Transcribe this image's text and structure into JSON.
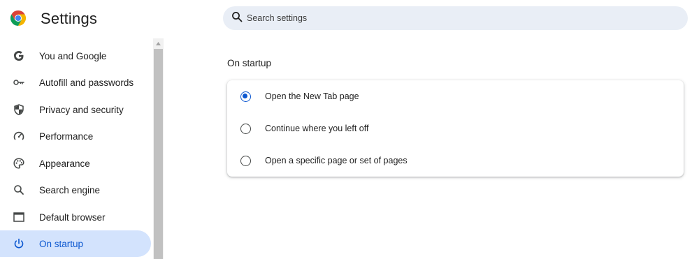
{
  "app": {
    "title": "Settings",
    "logo_icon": "chrome-logo-icon"
  },
  "search": {
    "placeholder": "Search settings",
    "value": ""
  },
  "sidebar": {
    "items": [
      {
        "label": "You and Google",
        "icon": "google-g-icon",
        "active": false
      },
      {
        "label": "Autofill and passwords",
        "icon": "key-icon",
        "active": false
      },
      {
        "label": "Privacy and security",
        "icon": "shield-icon",
        "active": false
      },
      {
        "label": "Performance",
        "icon": "speedometer-icon",
        "active": false
      },
      {
        "label": "Appearance",
        "icon": "palette-icon",
        "active": false
      },
      {
        "label": "Search engine",
        "icon": "search-icon",
        "active": false
      },
      {
        "label": "Default browser",
        "icon": "browser-window-icon",
        "active": false
      },
      {
        "label": "On startup",
        "icon": "power-icon",
        "active": true
      }
    ]
  },
  "main": {
    "section_title": "On startup",
    "options": [
      {
        "label": "Open the New Tab page",
        "checked": true
      },
      {
        "label": "Continue where you left off",
        "checked": false
      },
      {
        "label": "Open a specific page or set of pages",
        "checked": false
      }
    ]
  },
  "colors": {
    "accent": "#0b57d0",
    "active_bg": "#d3e3fd",
    "search_bg": "#e9eef6"
  }
}
